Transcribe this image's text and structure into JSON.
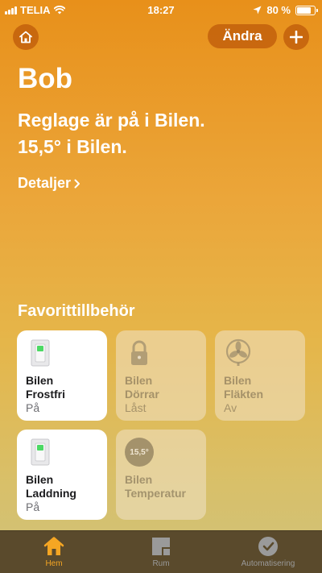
{
  "status_bar": {
    "carrier": "TELIA",
    "time": "18:27",
    "battery_text": "80 %",
    "battery_level": 0.8
  },
  "header": {
    "home_icon": "house-icon",
    "edit_label": "Ändra",
    "add_icon": "plus-icon"
  },
  "home": {
    "title": "Bob",
    "summary_line1": "Reglage är på i Bilen.",
    "summary_line2": "15,5° i Bilen.",
    "details_label": "Detaljer"
  },
  "favorites": {
    "title": "Favorittillbehör",
    "tiles": [
      {
        "room": "Bilen",
        "name": "Frostfri",
        "state": "På",
        "icon": "switch-icon",
        "active": true
      },
      {
        "room": "Bilen",
        "name": "Dörrar",
        "state": "Låst",
        "icon": "lock-icon",
        "active": false
      },
      {
        "room": "Bilen",
        "name": "Fläkten",
        "state": "Av",
        "icon": "fan-icon",
        "active": false
      },
      {
        "room": "Bilen",
        "name": "Laddning",
        "state": "På",
        "icon": "switch-icon",
        "active": true
      },
      {
        "room": "Bilen",
        "name": "Temperatur",
        "state": "",
        "icon": "thermometer-icon",
        "active": false,
        "badge": "15,5°"
      }
    ]
  },
  "tab_bar": {
    "tabs": [
      {
        "label": "Hem",
        "icon": "house-icon",
        "active": true
      },
      {
        "label": "Rum",
        "icon": "rooms-icon",
        "active": false
      },
      {
        "label": "Automatisering",
        "icon": "clock-icon",
        "active": false
      }
    ]
  },
  "colors": {
    "accent": "#f5a623",
    "background_top": "#e8901a",
    "tab_bar": "#5a4a2c"
  }
}
